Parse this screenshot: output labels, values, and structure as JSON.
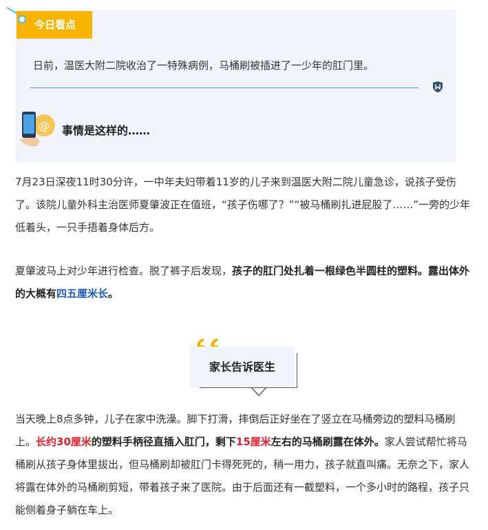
{
  "panel": {
    "tag": "今日看点",
    "intro": "日前，温医大附二院收治了一特殊病例，马桶刷被插进了一少年的肛门里。",
    "subtitle": "事情是这样的……"
  },
  "paragraph1": {
    "text": "7月23日深夜11时30分许，一中年夫妇带着11岁的儿子来到温医大附二院儿童急诊，说孩子受伤了。该院儿童外科主治医师夏肇波正在值班，“孩子伤哪了？”“被马桶刷扎进屁股了……”一旁的少年低着头，一只手捂着身体后方。"
  },
  "paragraph2": {
    "lead": "夏肇波马上对少年进行检查。脱了裤子后发现，",
    "bold": "孩子的肛门处扎着一根绿色半圆柱的塑料。露出体外的大概有",
    "highlight": "四五厘米长",
    "end": "。"
  },
  "quote": {
    "label": "家长告诉医生"
  },
  "paragraph3": {
    "lead": "当天晚上8点多钟，儿子在家中洗澡。脚下打滑，摔倒后正好坐在了竖立在马桶旁边的塑料马桶刷上。",
    "red1": "长约30厘米",
    "bold1": "的塑料手柄径直插入肛门，剩下",
    "red2": "15厘米",
    "bold2": "左右的马桶刷露在体外。",
    "rest": "家人尝试帮忙将马桶刷从孩子身体里拔出，但马桶刷却被肛门卡得死死的，稍一用力，孩子就直叫痛。无奈之下，家人将露在体外的马桶刷剪短，带着孩子来了医院。由于后面还有一截塑料，一个多小时的路程，孩子只能侧着身子躺在车上。"
  },
  "colors": {
    "accent_yellow": "#f5b400",
    "panel_bg": "#f1f5fb",
    "link_blue": "#1e5bb8",
    "highlight_red": "#e0212b"
  }
}
